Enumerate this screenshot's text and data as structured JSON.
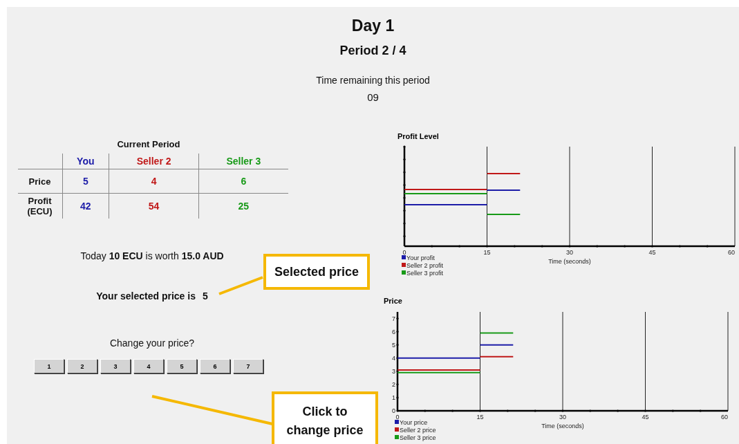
{
  "header": {
    "day_title": "Day 1",
    "period": "Period 2 / 4",
    "timer_label": "Time remaining this period",
    "timer_value": "09"
  },
  "current_period": {
    "title": "Current Period",
    "columns": [
      {
        "label": "You",
        "color": "#1c1ca8"
      },
      {
        "label": "Seller 2",
        "color": "#c01818"
      },
      {
        "label": "Seller 3",
        "color": "#189a18"
      }
    ],
    "rows": [
      {
        "label": "Price",
        "values": [
          "5",
          "4",
          "6"
        ]
      },
      {
        "label": "Profit (ECU)",
        "values": [
          "42",
          "54",
          "25"
        ]
      }
    ]
  },
  "exchange": "Today **10 ECU**  is worth **15.0 AUD**",
  "selected_price": {
    "label": "Your selected price is",
    "value": "5"
  },
  "change_price": {
    "prompt": "Change your price?",
    "buttons": [
      "1",
      "2",
      "3",
      "4",
      "5",
      "6",
      "7"
    ]
  },
  "profit_chart": {
    "title": "Profit Level",
    "xticks": [
      "0",
      "15",
      "30",
      "45",
      "60"
    ],
    "xlabel": "Time (seconds)",
    "legend": [
      {
        "label": "Your profit",
        "color": "#1c1ca8"
      },
      {
        "label": "Seller 2 profit",
        "color": "#c01818"
      },
      {
        "label": "Seller 3 profit",
        "color": "#189a18"
      }
    ]
  },
  "price_chart": {
    "chart_data": {
      "type": "line",
      "title": "Price",
      "xlabel": "Time (seconds)",
      "x": [
        0,
        15,
        15,
        21
      ],
      "xlim": [
        0,
        60
      ],
      "ylim": [
        0,
        7.5
      ],
      "xticks": [
        0,
        15,
        30,
        45,
        60
      ],
      "yticks": [
        0,
        1,
        2,
        3,
        4,
        5,
        6,
        7
      ],
      "grid": "x",
      "legend": "bottom-left",
      "series": [
        {
          "name": "Your price",
          "color": "#1c1ca8",
          "values": [
            4,
            4,
            5,
            5
          ]
        },
        {
          "name": "Seller 2 price",
          "color": "#c01818",
          "values": [
            3.1,
            3.1,
            4.1,
            4.1
          ]
        },
        {
          "name": "Seller 3 price",
          "color": "#189a18",
          "values": [
            2.9,
            2.9,
            5.9,
            5.9
          ]
        }
      ]
    }
  },
  "callouts": [
    {
      "text": "Selected price"
    },
    {
      "text": "Click to change price"
    }
  ]
}
